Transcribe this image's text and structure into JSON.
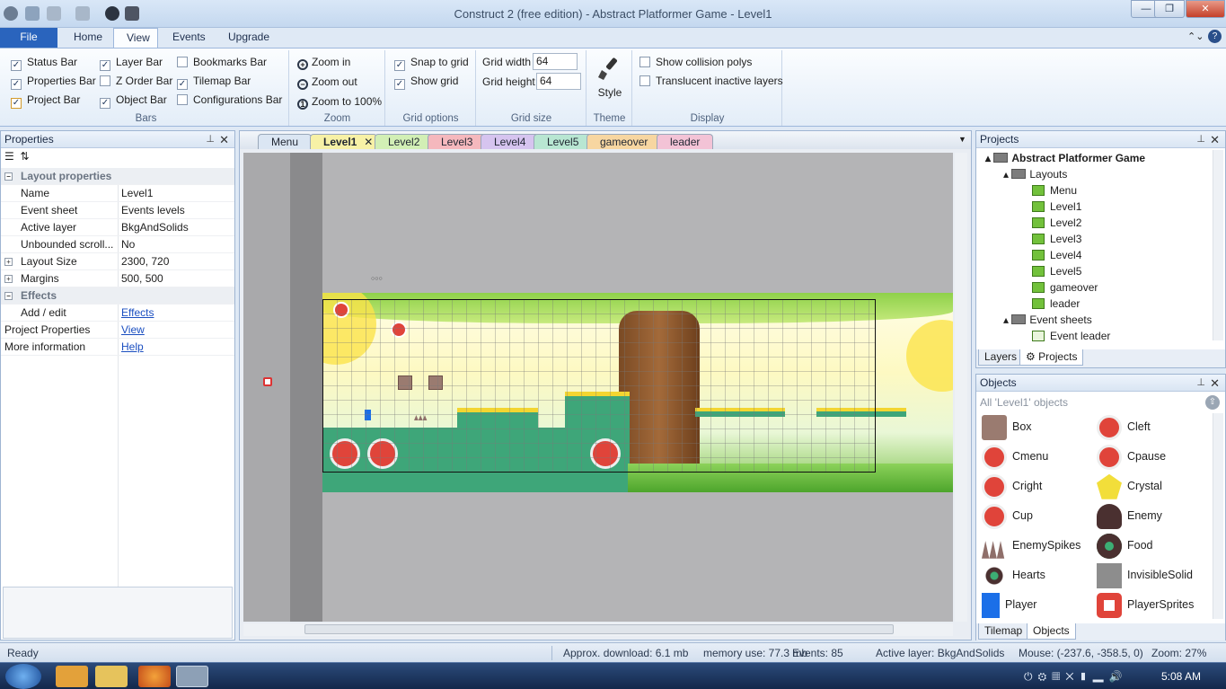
{
  "window": {
    "title": "Construct 2  (free edition) - Abstract Platformer Game - Level1",
    "minimize": "—",
    "maximize": "❐",
    "close": "✕"
  },
  "ribbon_tabs": [
    "File",
    "Home",
    "View",
    "Events",
    "Upgrade"
  ],
  "bars": {
    "label": "Bars",
    "items": [
      {
        "label": "Status Bar",
        "checked": true
      },
      {
        "label": "Properties Bar",
        "checked": true
      },
      {
        "label": "Project Bar",
        "checked": true
      },
      {
        "label": "Layer Bar",
        "checked": true
      },
      {
        "label": "Z Order Bar",
        "checked": false
      },
      {
        "label": "Object Bar",
        "checked": true
      },
      {
        "label": "Bookmarks Bar",
        "checked": false
      },
      {
        "label": "Tilemap Bar",
        "checked": true
      },
      {
        "label": "Configurations Bar",
        "checked": false
      }
    ]
  },
  "zoom": {
    "label": "Zoom",
    "zoom_in": "Zoom in",
    "zoom_out": "Zoom out",
    "zoom_100": "Zoom to 100%"
  },
  "grid_options": {
    "label": "Grid options",
    "snap": "Snap to grid",
    "show": "Show grid"
  },
  "grid_size": {
    "label": "Grid size",
    "width_label": "Grid width",
    "width": "64",
    "height_label": "Grid height",
    "height": "64"
  },
  "theme": {
    "label": "Theme",
    "style": "Style"
  },
  "display": {
    "label": "Display",
    "collision": "Show collision polys",
    "translucent": "Translucent inactive layers"
  },
  "properties": {
    "title": "Properties",
    "layout_section": "Layout properties",
    "rows": [
      {
        "k": "Name",
        "v": "Level1"
      },
      {
        "k": "Event sheet",
        "v": "Events levels"
      },
      {
        "k": "Active layer",
        "v": "BkgAndSolids"
      },
      {
        "k": "Unbounded scroll...",
        "v": "No"
      },
      {
        "k": "Layout Size",
        "v": "2300, 720"
      },
      {
        "k": "Margins",
        "v": "500, 500"
      }
    ],
    "effects_section": "Effects",
    "add_edit": "Add / edit",
    "effects_link": "Effects",
    "project_properties": "Project Properties",
    "view_link": "View",
    "more_info": "More information",
    "help_link": "Help"
  },
  "layout_tabs": [
    {
      "label": "Menu",
      "color": "#dbe6f3"
    },
    {
      "label": "Level1",
      "color": "#f7f1a6"
    },
    {
      "label": "Level2",
      "color": "#d2efb5"
    },
    {
      "label": "Level3",
      "color": "#f5b8bd"
    },
    {
      "label": "Level4",
      "color": "#d6c4ef"
    },
    {
      "label": "Level5",
      "color": "#b8e6d2"
    },
    {
      "label": "gameover",
      "color": "#f7d6a1"
    },
    {
      "label": "leader",
      "color": "#f3c3d6"
    }
  ],
  "projects": {
    "title": "Projects",
    "root": "Abstract Platformer Game",
    "layouts": "Layouts",
    "layout_items": [
      "Menu",
      "Level1",
      "Level2",
      "Level3",
      "Level4",
      "Level5",
      "gameover",
      "leader"
    ],
    "event_sheets": "Event sheets",
    "event_items": [
      "Event leader"
    ],
    "tab_layers": "Layers",
    "tab_projects": "Projects"
  },
  "objects": {
    "title": "Objects",
    "filter": "All 'Level1' objects",
    "items": [
      {
        "name": "Box",
        "icon": "box-icon"
      },
      {
        "name": "Cleft",
        "icon": "arrow-left-button-icon"
      },
      {
        "name": "Cmenu",
        "icon": "menu-button-icon"
      },
      {
        "name": "Cpause",
        "icon": "pause-button-icon"
      },
      {
        "name": "Cright",
        "icon": "arrow-right-button-icon"
      },
      {
        "name": "Crystal",
        "icon": "crystal-icon"
      },
      {
        "name": "Cup",
        "icon": "arrow-up-button-icon"
      },
      {
        "name": "Enemy",
        "icon": "enemy-icon"
      },
      {
        "name": "EnemySpikes",
        "icon": "spikes-icon"
      },
      {
        "name": "Food",
        "icon": "food-icon"
      },
      {
        "name": "Hearts",
        "icon": "heart-icon"
      },
      {
        "name": "InvisibleSolid",
        "icon": "invisible-solid-icon"
      },
      {
        "name": "Player",
        "icon": "player-icon"
      },
      {
        "name": "PlayerSprites",
        "icon": "player-sprites-icon"
      }
    ],
    "tab_tilemap": "Tilemap",
    "tab_objects": "Objects"
  },
  "status": {
    "ready": "Ready",
    "download": "Approx. download: 6.1 mb",
    "memory": "memory use: 77.3 mb",
    "events": "Events: 85",
    "active_layer": "Active layer: BkgAndSolids",
    "mouse": "Mouse: (-237.6, -358.5, 0)",
    "zoom": "Zoom: 27%"
  },
  "taskbar": {
    "time": "5:08 AM"
  }
}
